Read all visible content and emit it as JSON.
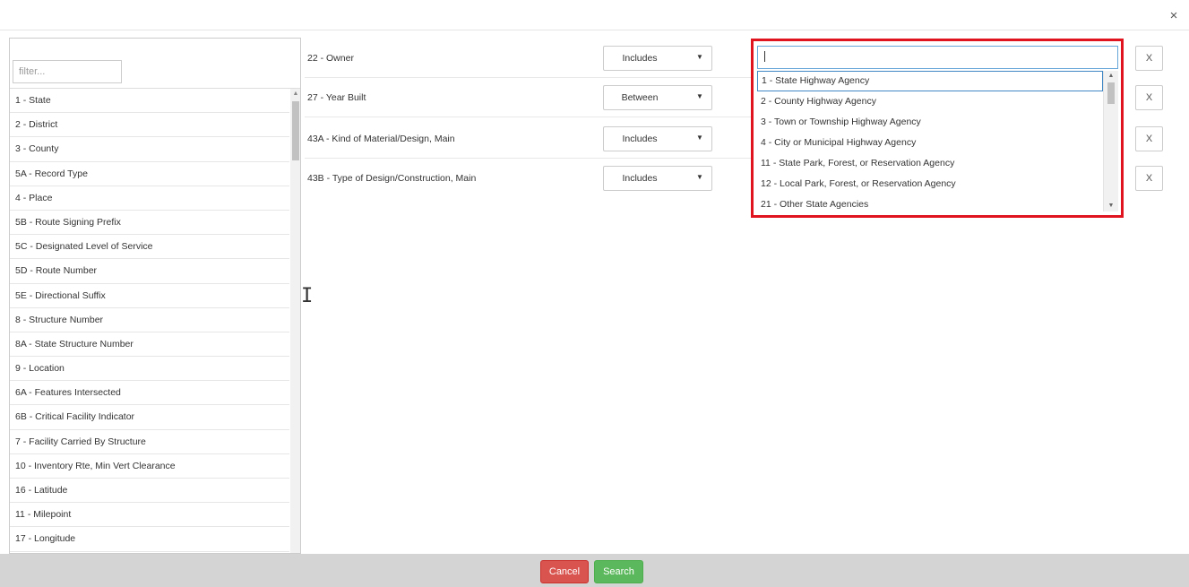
{
  "dialog": {
    "close_label": "×"
  },
  "left": {
    "filter_placeholder": "filter...",
    "fields": [
      "1 - State",
      "2 - District",
      "3 - County",
      "5A - Record Type",
      "4 - Place",
      "5B - Route Signing Prefix",
      "5C - Designated Level of Service",
      "5D - Route Number",
      "5E - Directional Suffix",
      "8 - Structure Number",
      "8A - State Structure Number",
      "9 - Location",
      "6A - Features Intersected",
      "6B - Critical Facility Indicator",
      "7 - Facility Carried By Structure",
      "10 - Inventory Rte, Min Vert Clearance",
      "16 - Latitude",
      "11 - Milepoint",
      "17 - Longitude"
    ]
  },
  "criteria": [
    {
      "label": "22 - Owner",
      "operator": "Includes",
      "remove": "X"
    },
    {
      "label": "27 - Year Built",
      "operator": "Between",
      "remove": "X"
    },
    {
      "label": "43A - Kind of Material/Design, Main",
      "operator": "Includes",
      "remove": "X"
    },
    {
      "label": "43B - Type of Design/Construction, Main",
      "operator": "Includes",
      "remove": "X"
    }
  ],
  "value_dropdown": {
    "input_value": "",
    "options": [
      "1 - State Highway Agency",
      "2 - County Highway Agency",
      "3 - Town or Township Highway Agency",
      "4 - City or Municipal Highway Agency",
      "11 - State Park, Forest, or Reservation Agency",
      "12 - Local Park, Forest, or Reservation Agency",
      "21 - Other State Agencies"
    ],
    "selected_index": 0,
    "highlight_color": "#e0141e"
  },
  "footer": {
    "cancel_label": "Cancel",
    "search_label": "Search",
    "cancel_color": "#d9534f",
    "search_color": "#5cb85c"
  },
  "misc": {
    "text_cursor_glyph": "I"
  }
}
